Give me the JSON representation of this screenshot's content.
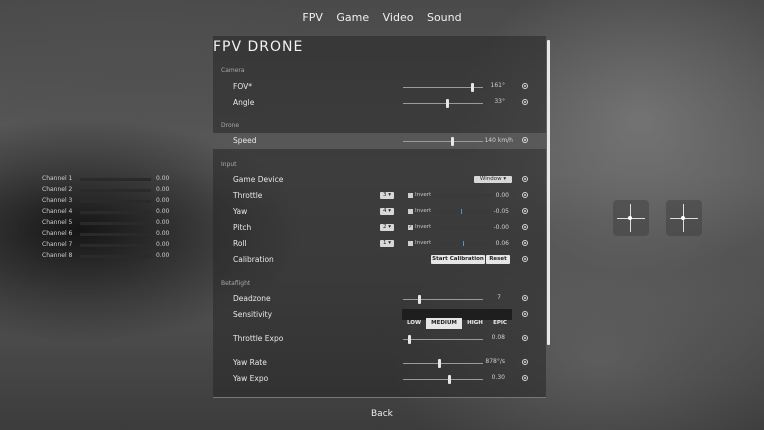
{
  "nav": {
    "tabs": [
      "FPV",
      "Game",
      "Video",
      "Sound"
    ]
  },
  "panel": {
    "title": "FPV DRONE",
    "sections": {
      "camera": "Camera",
      "drone": "Drone",
      "input": "Input",
      "betaflight": "Betaflight"
    },
    "fov": {
      "label": "FOV*",
      "value": "161°",
      "level": 0.86
    },
    "angle": {
      "label": "Angle",
      "value": "33°",
      "level": 0.55
    },
    "speed": {
      "label": "Speed",
      "value": "140 km/h",
      "level": 0.61
    },
    "game_device": {
      "label": "Game Device",
      "value": "Window ▾"
    },
    "throttle": {
      "label": "Throttle",
      "channel": "3 ▾",
      "invert": "Invert",
      "inverted": false,
      "value": "0.00",
      "position": 0.0
    },
    "yaw": {
      "label": "Yaw",
      "channel": "4 ▾",
      "invert": "Invert",
      "inverted": false,
      "value": "-0.05",
      "position": 0.5
    },
    "pitch": {
      "label": "Pitch",
      "channel": "2 ▾",
      "invert": "Invert",
      "inverted": true,
      "value": "-0.00",
      "position": 0.5
    },
    "roll": {
      "label": "Roll",
      "channel": "1 ▾",
      "invert": "Invert",
      "inverted": false,
      "value": "0.06",
      "position": 0.55
    },
    "calibration": {
      "label": "Calibration",
      "start": "Start Calibration",
      "reset": "Reset"
    },
    "deadzone": {
      "label": "Deadzone",
      "value": "7",
      "level": 0.2
    },
    "sensitivity": {
      "label": "Sensitivity",
      "options": [
        "LOW",
        "MEDIUM",
        "HIGH",
        "EPIC"
      ],
      "selected": "MEDIUM"
    },
    "throttle_expo": {
      "label": "Throttle Expo",
      "value": "0.08",
      "level": 0.08
    },
    "yaw_rate": {
      "label": "Yaw Rate",
      "value": "878°/s",
      "level": 0.45
    },
    "yaw_expo": {
      "label": "Yaw Expo",
      "value": "0.30",
      "level": 0.58
    }
  },
  "channels": [
    {
      "label": "Channel 1",
      "value": "0.00"
    },
    {
      "label": "Channel 2",
      "value": "0.00"
    },
    {
      "label": "Channel 3",
      "value": "0.00"
    },
    {
      "label": "Channel 4",
      "value": "0.00"
    },
    {
      "label": "Channel 5",
      "value": "0.00"
    },
    {
      "label": "Channel 6",
      "value": "0.00"
    },
    {
      "label": "Channel 7",
      "value": "0.00"
    },
    {
      "label": "Channel 8",
      "value": "0.00"
    }
  ],
  "back_label": "Back"
}
